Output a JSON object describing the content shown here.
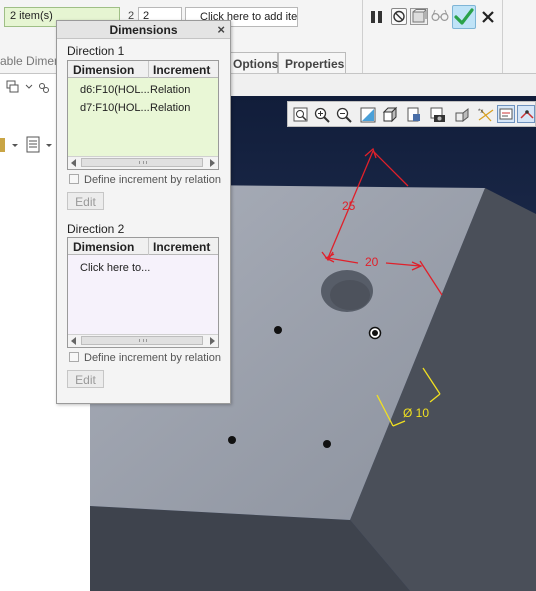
{
  "dashboard": {
    "items_field": "2 item(s)",
    "count_label": "2",
    "count_field": "2",
    "add_item_placeholder": "Click here to add item",
    "tab_left_partial": "able Dimen",
    "tabs": [
      {
        "label": "Options"
      },
      {
        "label": "Properties"
      }
    ]
  },
  "dialog": {
    "title": "Dimensions",
    "direction1": {
      "label": "Direction 1",
      "columns": [
        "Dimension",
        "Increment"
      ],
      "rows": [
        {
          "dimension": "d6:F10(HOL...",
          "increment": "Relation"
        },
        {
          "dimension": "d7:F10(HOL...",
          "increment": "Relation"
        }
      ],
      "checkbox_label": "Define increment by relation",
      "edit_label": "Edit"
    },
    "direction2": {
      "label": "Direction 2",
      "columns": [
        "Dimension",
        "Increment"
      ],
      "placeholder_row": "Click here to...",
      "checkbox_label": "Define increment by relation",
      "edit_label": "Edit"
    },
    "scroll_grip": "III"
  },
  "model": {
    "dim_25": "25",
    "dim_20": "20",
    "dim_dia": "Ø 10"
  },
  "colors": {
    "grid_selected_bg": "#e9f7d6",
    "grid2_bg": "#f6f2fb",
    "dim_red": "#e0202a",
    "dim_yellow": "#f1e020",
    "background_blue": "#1f2a44"
  }
}
